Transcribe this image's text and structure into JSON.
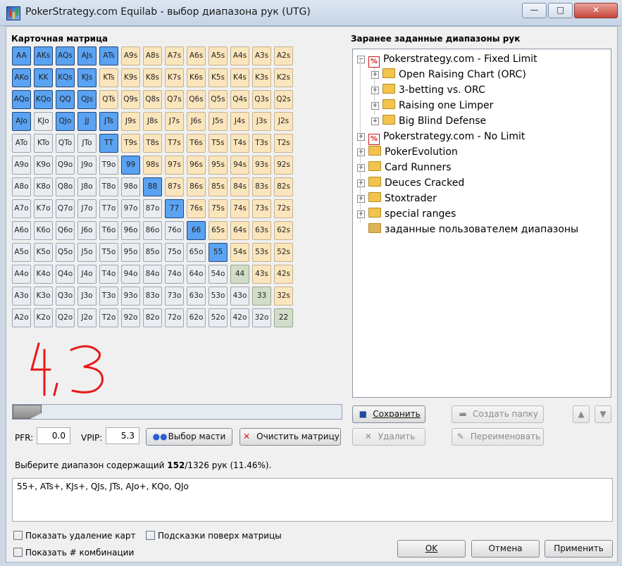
{
  "window": {
    "title": "PokerStrategy.com Equilab - выбор диапазона рук (UTG)",
    "buttons": {
      "minimize": "—",
      "maximize": "□",
      "close": "✕"
    }
  },
  "matrix": {
    "title": "Карточная матрица",
    "rows": [
      [
        "AA",
        "AKs",
        "AQs",
        "AJs",
        "ATs",
        "A9s",
        "A8s",
        "A7s",
        "A6s",
        "A5s",
        "A4s",
        "A3s",
        "A2s"
      ],
      [
        "AKo",
        "KK",
        "KQs",
        "KJs",
        "KTs",
        "K9s",
        "K8s",
        "K7s",
        "K6s",
        "K5s",
        "K4s",
        "K3s",
        "K2s"
      ],
      [
        "AQo",
        "KQo",
        "QQ",
        "QJs",
        "QTs",
        "Q9s",
        "Q8s",
        "Q7s",
        "Q6s",
        "Q5s",
        "Q4s",
        "Q3s",
        "Q2s"
      ],
      [
        "AJo",
        "KJo",
        "QJo",
        "JJ",
        "JTs",
        "J9s",
        "J8s",
        "J7s",
        "J6s",
        "J5s",
        "J4s",
        "J3s",
        "J2s"
      ],
      [
        "ATo",
        "KTo",
        "QTo",
        "JTo",
        "TT",
        "T9s",
        "T8s",
        "T7s",
        "T6s",
        "T5s",
        "T4s",
        "T3s",
        "T2s"
      ],
      [
        "A9o",
        "K9o",
        "Q9o",
        "J9o",
        "T9o",
        "99",
        "98s",
        "97s",
        "96s",
        "95s",
        "94s",
        "93s",
        "92s"
      ],
      [
        "A8o",
        "K8o",
        "Q8o",
        "J8o",
        "T8o",
        "98o",
        "88",
        "87s",
        "86s",
        "85s",
        "84s",
        "83s",
        "82s"
      ],
      [
        "A7o",
        "K7o",
        "Q7o",
        "J7o",
        "T7o",
        "97o",
        "87o",
        "77",
        "76s",
        "75s",
        "74s",
        "73s",
        "72s"
      ],
      [
        "A6o",
        "K6o",
        "Q6o",
        "J6o",
        "T6o",
        "96o",
        "86o",
        "76o",
        "66",
        "65s",
        "64s",
        "63s",
        "62s"
      ],
      [
        "A5o",
        "K5o",
        "Q5o",
        "J5o",
        "T5o",
        "95o",
        "85o",
        "75o",
        "65o",
        "55",
        "54s",
        "53s",
        "52s"
      ],
      [
        "A4o",
        "K4o",
        "Q4o",
        "J4o",
        "T4o",
        "94o",
        "84o",
        "74o",
        "64o",
        "54o",
        "44",
        "43s",
        "42s"
      ],
      [
        "A3o",
        "K3o",
        "Q3o",
        "J3o",
        "T3o",
        "93o",
        "83o",
        "73o",
        "63o",
        "53o",
        "43o",
        "33",
        "32s"
      ],
      [
        "A2o",
        "K2o",
        "Q2o",
        "J2o",
        "T2o",
        "92o",
        "82o",
        "72o",
        "62o",
        "52o",
        "42o",
        "32o",
        "22"
      ]
    ],
    "selected": [
      "AA",
      "AKs",
      "AQs",
      "AJs",
      "ATs",
      "AKo",
      "KK",
      "KQs",
      "KJs",
      "AQo",
      "KQo",
      "QQ",
      "QJs",
      "AJo",
      "QJo",
      "JJ",
      "JTs",
      "TT",
      "99",
      "88",
      "77",
      "66",
      "55"
    ],
    "colors": {
      "selected": "#5aa2f2",
      "suited": "#fbe5bc",
      "offsuit": "#e9edf2",
      "pair": "#d2ddc9"
    }
  },
  "annotation_handwritten": "4,3",
  "slider": {
    "value": 0.1146
  },
  "controls": {
    "pfr_label": "PFR:",
    "pfr_value": "0.0",
    "vpip_label": "VPIP:",
    "vpip_value": "5.3",
    "suit_button": "Выбор масти",
    "clear_button": "Очистить матрицу"
  },
  "ranges": {
    "title": "Заранее заданные диапазоны рук",
    "tree": [
      {
        "label": "Pokerstrategy.com - Fixed Limit",
        "icon": "pokerstrategy-icon",
        "expanded": true
      },
      {
        "label": "Open Raising Chart (ORC)",
        "icon": "folder-icon",
        "child": true
      },
      {
        "label": "3-betting vs. ORC",
        "icon": "folder-icon",
        "child": true
      },
      {
        "label": "Raising one Limper",
        "icon": "folder-icon",
        "child": true
      },
      {
        "label": "Big Blind Defense",
        "icon": "folder-icon",
        "child": true
      },
      {
        "label": "Pokerstrategy.com - No Limit",
        "icon": "pokerstrategy-icon"
      },
      {
        "label": "PokerEvolution",
        "icon": "folder-icon"
      },
      {
        "label": "Card Runners",
        "icon": "folder-icon"
      },
      {
        "label": "Deuces Cracked",
        "icon": "folder-icon"
      },
      {
        "label": "Stoxtrader",
        "icon": "folder-icon"
      },
      {
        "label": "special ranges",
        "icon": "folder-icon"
      },
      {
        "label": "заданные пользователем диапазоны",
        "icon": "user-folder-icon"
      }
    ],
    "save_button": "Сохранить",
    "delete_button": "Удалить",
    "create_folder_button": "Создать папку",
    "rename_button": "Переименовать"
  },
  "summary": {
    "prefix": "Выберите диапазон содержащий ",
    "count": "152",
    "suffix": "/1326 рук (11.46%)."
  },
  "range_text": "55+, ATs+, KJs+, QJs, JTs, AJo+, KQo, QJo",
  "options": {
    "show_dead_cards": "Показать удаление карт",
    "show_combos": "Показать # комбинации",
    "hints_over_matrix": "Подсказки поверх матрицы"
  },
  "dialog": {
    "ok": "OK",
    "cancel": "Отмена",
    "apply": "Применить"
  }
}
